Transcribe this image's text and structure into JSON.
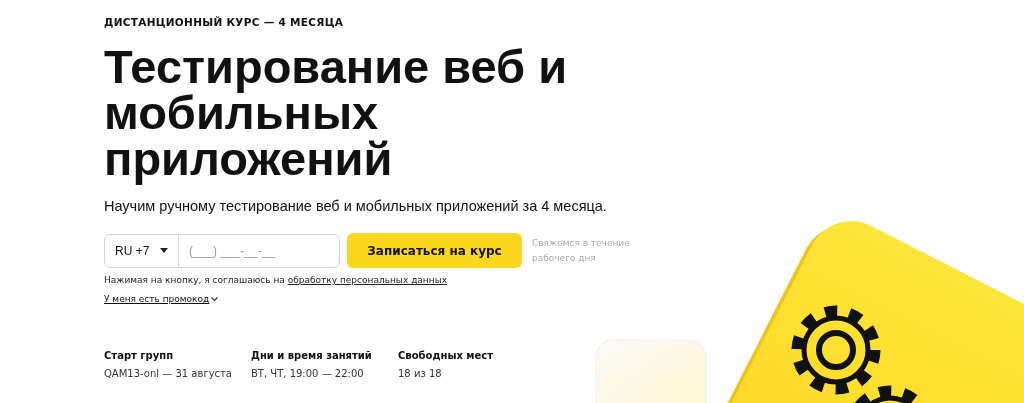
{
  "eyebrow": "ДИСТАНЦИОННЫЙ КУРС — 4 МЕСЯЦА",
  "title": "Тестирование веб и мобильных приложений",
  "subtitle": "Научим ручному тестирование веб и мобильных приложений за 4 месяца.",
  "phone": {
    "country": "RU +7",
    "placeholder": "(___) ___-__-__"
  },
  "submit": "Записаться на курс",
  "note": "Свяжемся в течение рабочего дня",
  "consent": {
    "text": "Нажимая на кнопку, я соглашаюсь на",
    "link": "обработку персональных данных"
  },
  "promo": "У меня есть промокод",
  "info": [
    {
      "label": "Старт групп",
      "value": "QAM13-onl — 31 августа"
    },
    {
      "label": "Дни и время занятий",
      "value": "ВТ, ЧТ, 19:00 — 22:00"
    },
    {
      "label": "Свободных мест",
      "value": "18 из 18"
    }
  ]
}
